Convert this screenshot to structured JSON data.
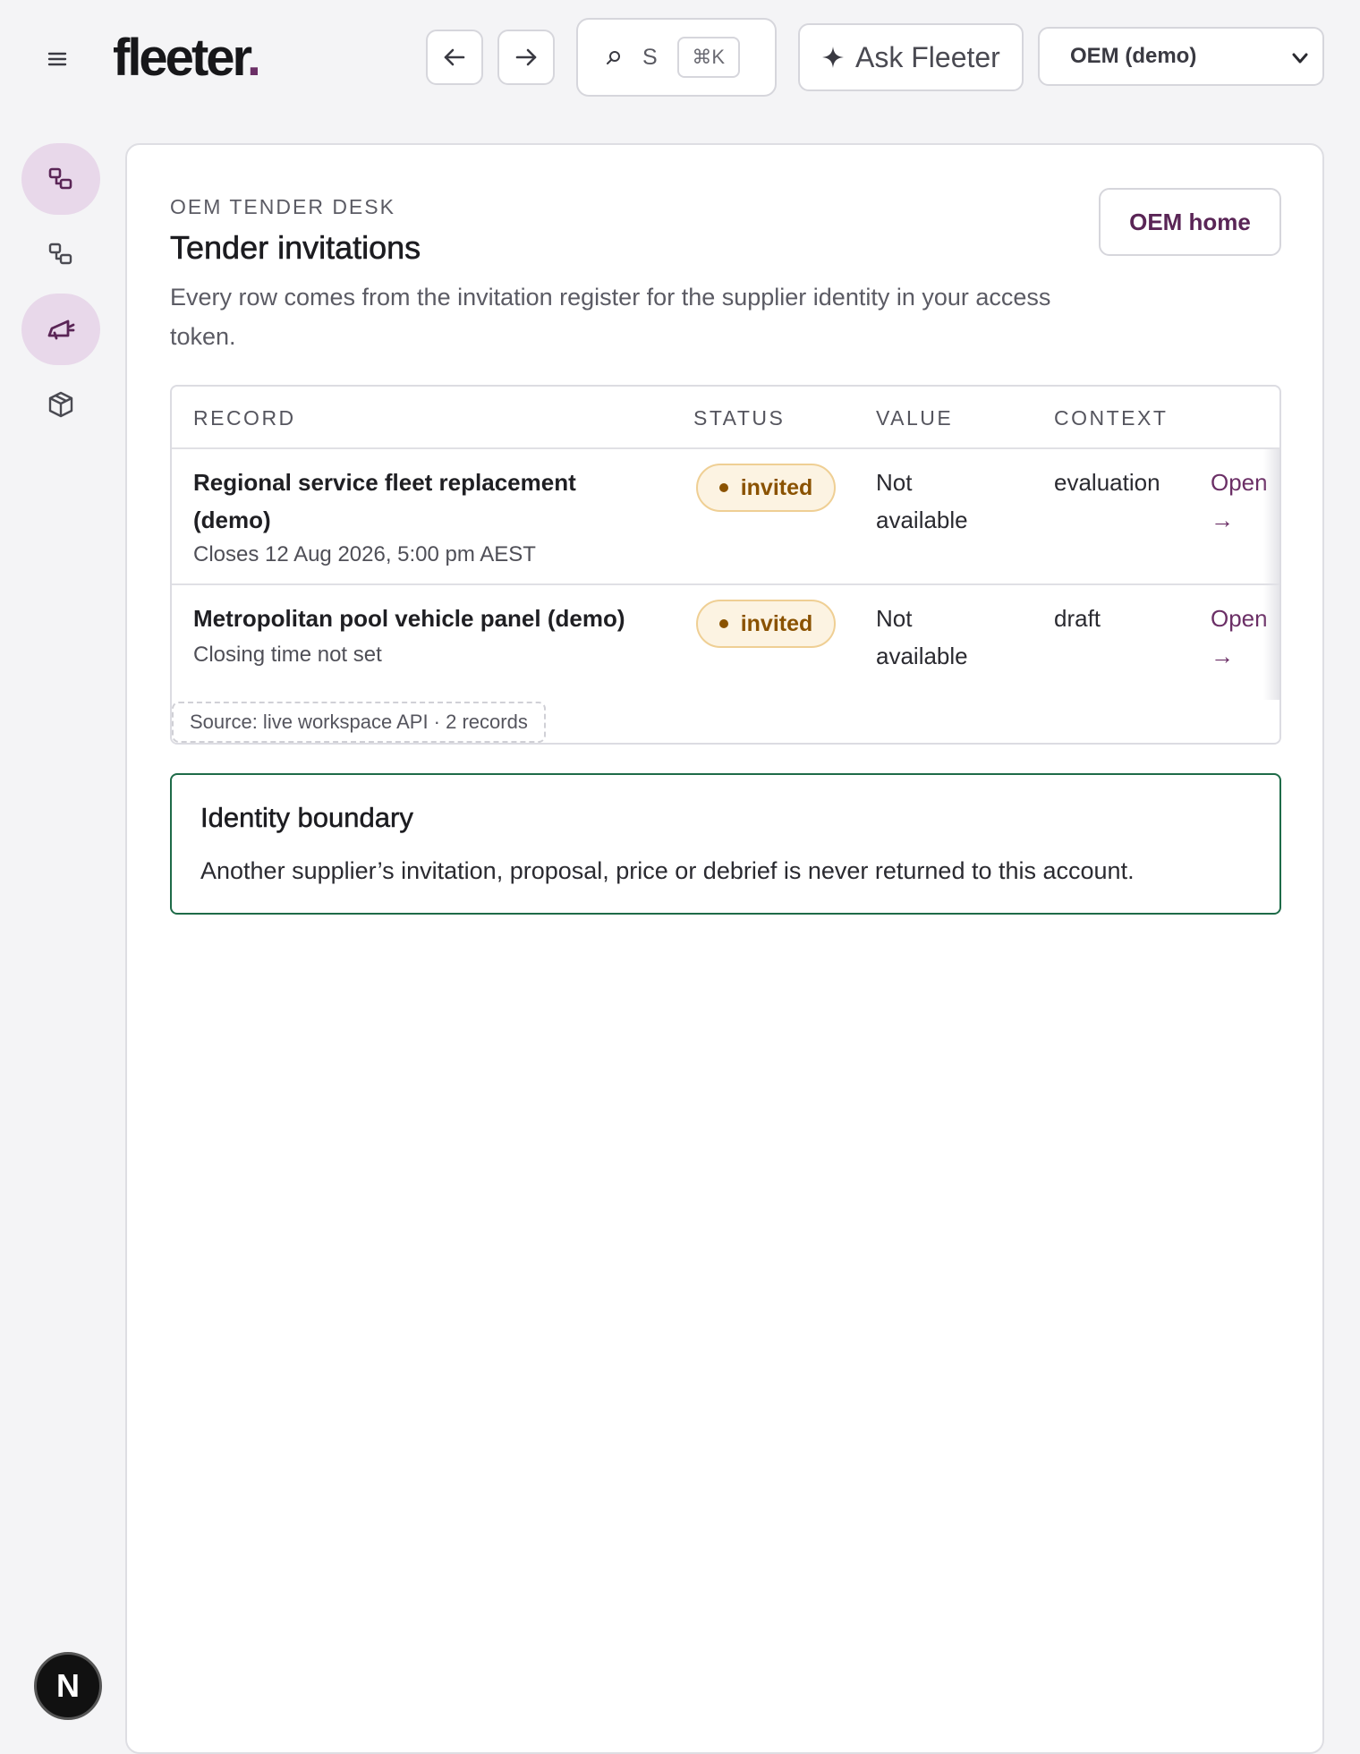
{
  "topbar": {
    "brand": "fleeter",
    "brand_dot": ".",
    "search_label": "S",
    "search_shortcut": "⌘K",
    "ask_label": "Ask Fleeter",
    "scope_value": "OEM (demo)"
  },
  "rail": {
    "items": [
      "tenders-icon",
      "tenders-alt-icon",
      "megaphone-icon",
      "package-icon"
    ],
    "active": [
      0,
      2
    ]
  },
  "page": {
    "eyebrow": "OEM TENDER DESK",
    "title": "Tender invitations",
    "description": "Every row comes from the invitation register for the supplier identity in your access token.",
    "home_button": "OEM home"
  },
  "table": {
    "columns": [
      "RECORD",
      "STATUS",
      "VALUE",
      "CONTEXT"
    ],
    "rows": [
      {
        "title": "Regional service fleet replacement (demo)",
        "subtitle": "Closes 12 Aug 2026, 5:00 pm AEST",
        "status": "invited",
        "value": "Not available",
        "context": "evaluation",
        "action": "Open →"
      },
      {
        "title": "Metropolitan pool vehicle panel (demo)",
        "subtitle": "Closing time not set",
        "status": "invited",
        "value": "Not available",
        "context": "draft",
        "action": "Open →"
      }
    ],
    "source": "Source: live workspace API · 2 records"
  },
  "boundary": {
    "title": "Identity boundary",
    "text": "Another supplier’s invitation, proposal, price or debrief is never returned to this account."
  },
  "badge": {
    "label": "N"
  },
  "colors": {
    "accent": "#6b2f66",
    "rail_active": "#e8d8ea",
    "status_bg": "#fcf3e2",
    "status_text": "#8a5200",
    "boundary_border": "#1e6b48"
  }
}
